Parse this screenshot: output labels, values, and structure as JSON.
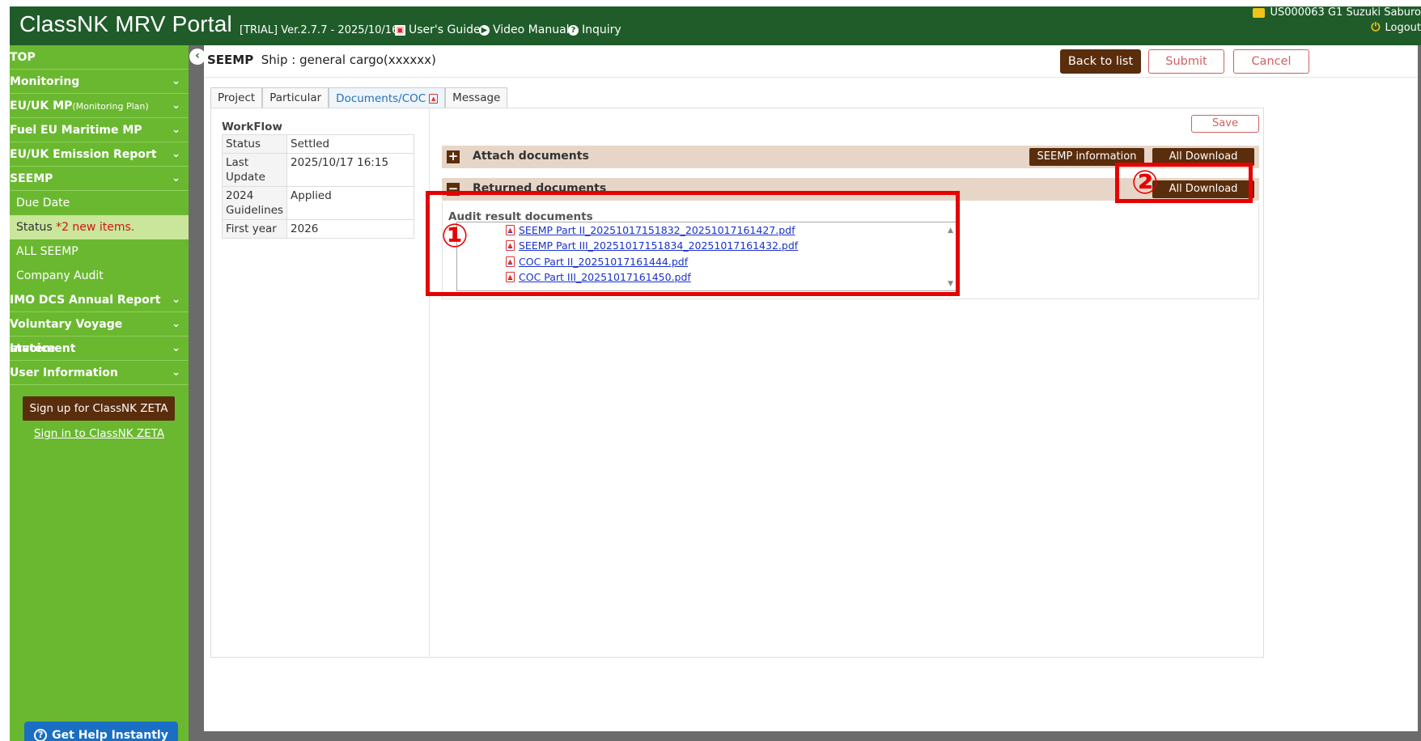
{
  "header": {
    "app_title": "ClassNK MRV Portal",
    "version": "[TRIAL]  Ver.2.7.7 - 2025/10/16",
    "links": {
      "users_guide": "User's Guide",
      "video_manual": "Video Manual",
      "inquiry": "Inquiry"
    },
    "user": "US000063 G1 Suzuki Saburo",
    "logout": "Logout"
  },
  "sidebar": {
    "items": [
      {
        "label": "TOP"
      },
      {
        "label": "Monitoring"
      },
      {
        "label": "EU/UK MP",
        "small": "(Monitoring Plan)"
      },
      {
        "label": "Fuel EU Maritime MP"
      },
      {
        "label": "EU/UK Emission Report"
      },
      {
        "label": "SEEMP"
      },
      {
        "label": "IMO DCS Annual Report"
      },
      {
        "label": "Voluntary Voyage statement"
      },
      {
        "label": "Invoice"
      },
      {
        "label": "User Information"
      }
    ],
    "seemp_sub": {
      "due_date": "Due Date",
      "status": "Status",
      "status_note": "*2 new items.",
      "all_seemp": "ALL SEEMP",
      "company_audit": "Company Audit"
    },
    "zeta_signup": "Sign up for ClassNK ZETA",
    "zeta_signin": "Sign in to ClassNK ZETA",
    "help": "Get Help Instantly"
  },
  "main": {
    "title_bold": "SEEMP",
    "title_rest": "Ship : general cargo(xxxxxx)",
    "buttons": {
      "back": "Back to list",
      "submit": "Submit",
      "cancel": "Cancel",
      "save": "Save"
    },
    "tabs": [
      "Project",
      "Particular",
      "Documents/COC",
      "Message"
    ],
    "workflow": {
      "title": "WorkFlow",
      "rows": [
        {
          "k": "Status",
          "v": "Settled"
        },
        {
          "k": "Last Update",
          "v": "2025/10/17 16:15"
        },
        {
          "k": "2024 Guidelines",
          "v": "Applied"
        },
        {
          "k": "First year",
          "v": "2026"
        }
      ]
    },
    "attach": {
      "label": "Attach documents",
      "seemp_info": "SEEMP information",
      "all_download": "All Download"
    },
    "returned": {
      "label": "Returned documents",
      "all_download": "All Download"
    },
    "audit_title": "Audit result documents",
    "files": [
      "SEEMP Part II_20251017151832_20251017161427.pdf",
      "SEEMP Part III_20251017151834_20251017161432.pdf",
      "COC Part II_20251017161444.pdf",
      "COC Part III_20251017161450.pdf"
    ]
  },
  "annotations": {
    "one": "①",
    "two": "②"
  }
}
